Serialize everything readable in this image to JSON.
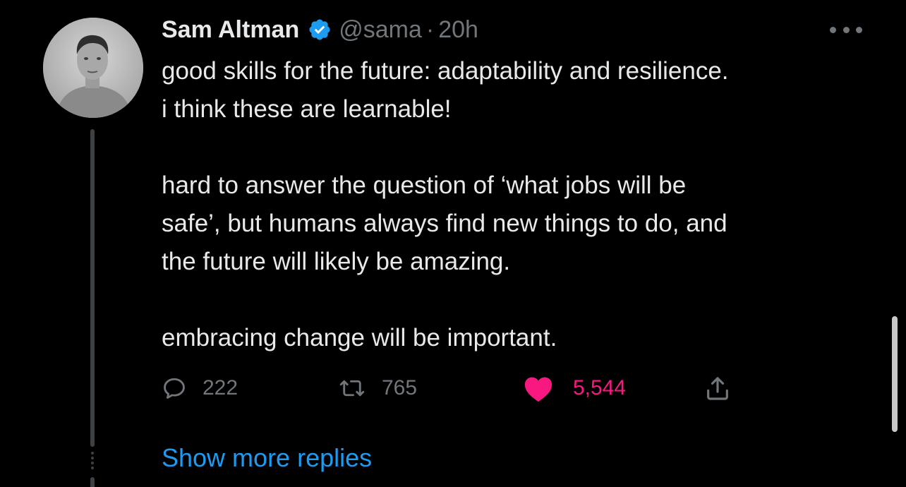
{
  "author": {
    "name": "Sam Altman",
    "handle": "@sama",
    "separator": "·",
    "time": "20h",
    "verified": true,
    "avatar_icon": "profile-photo"
  },
  "tweet": {
    "paragraph_1": "good skills for the future: adaptability and resilience.\ni think these are learnable!",
    "paragraph_2": "hard to answer the question of ‘what jobs will be\nsafe’, but humans always find new things to do, and\nthe future will likely be amazing.",
    "paragraph_3": "embracing change will be important."
  },
  "actions": {
    "reply": {
      "icon": "reply-icon",
      "count": "222"
    },
    "retweet": {
      "icon": "retweet-icon",
      "count": "765"
    },
    "like": {
      "icon": "heart-icon",
      "count": "5,544",
      "liked": true
    },
    "share": {
      "icon": "share-icon"
    }
  },
  "footer": {
    "show_more_label": "Show more replies"
  },
  "colors": {
    "background": "#000000",
    "text": "#e7e9ea",
    "muted": "#71767b",
    "link": "#1d9bf0",
    "like": "#f91880",
    "verified": "#1d9bf0"
  }
}
